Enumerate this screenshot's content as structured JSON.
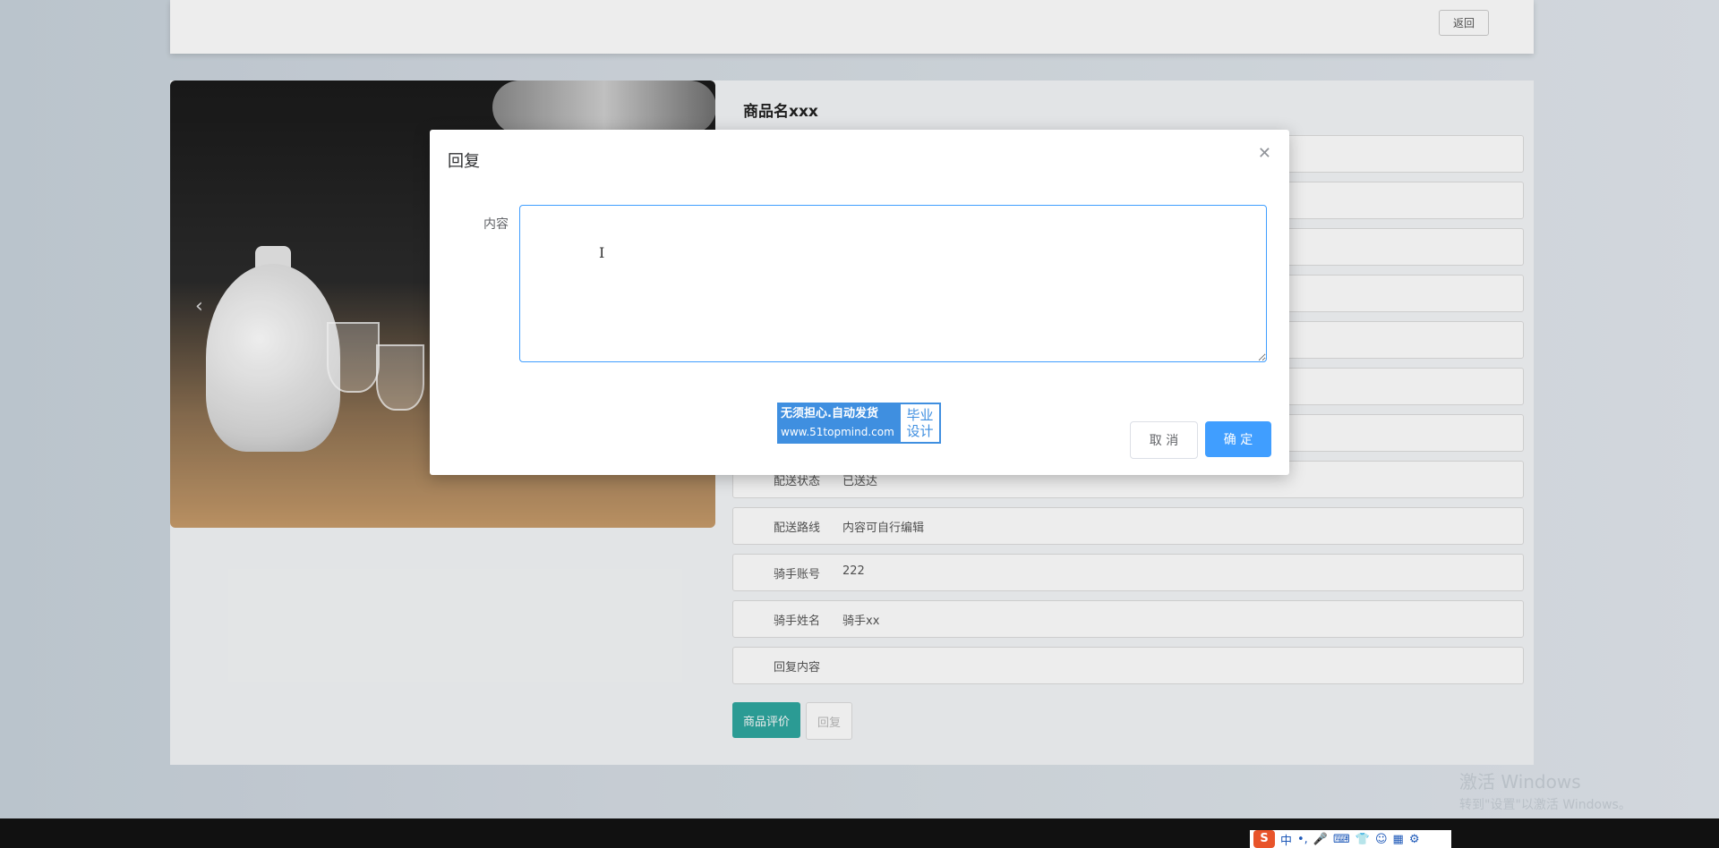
{
  "header": {
    "back_label": "返回"
  },
  "product": {
    "title": "商品名xxx",
    "fields": [
      {
        "label": "配送状态",
        "value": "已送达"
      },
      {
        "label": "配送路线",
        "value": "内容可自行编辑"
      },
      {
        "label": "骑手账号",
        "value": "222"
      },
      {
        "label": "骑手姓名",
        "value": "骑手xx"
      },
      {
        "label": "回复内容",
        "value": ""
      }
    ],
    "review_label": "商品评价",
    "reply_label": "回复"
  },
  "dialog": {
    "title": "回复",
    "content_label": "内容",
    "content_value": "",
    "cancel_label": "取 消",
    "confirm_label": "确 定"
  },
  "ad": {
    "line1": "无须担心.自动发货",
    "url": "www.51topmind.com",
    "badge_line1": "毕业",
    "badge_line2": "设计"
  },
  "taskbar": {
    "ime_lang": "中",
    "ime_punct": "•,"
  },
  "watermark": {
    "title": "激活 Windows",
    "subtitle": "转到\"设置\"以激活 Windows。"
  }
}
